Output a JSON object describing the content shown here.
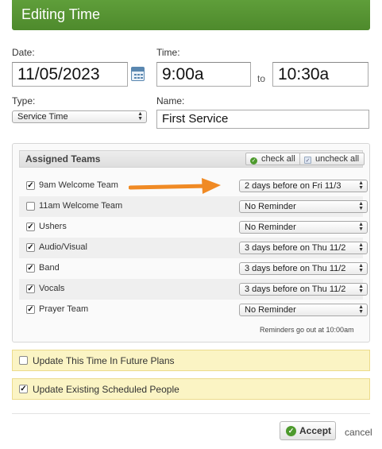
{
  "header": {
    "title": "Editing Time"
  },
  "form": {
    "date_label": "Date:",
    "date_value": "11/05/2023",
    "time_label": "Time:",
    "time_start": "9:00a",
    "to_label": "to",
    "time_end": "10:30a",
    "type_label": "Type:",
    "type_value": "Service Time",
    "name_label": "Name:",
    "name_value": "First Service"
  },
  "assigned_teams": {
    "title": "Assigned Teams",
    "check_all": "check all",
    "uncheck_all": "uncheck all",
    "teams": [
      {
        "name": "9am Welcome Team",
        "checked": true,
        "reminder": "2 days before on Fri 11/3"
      },
      {
        "name": "11am Welcome Team",
        "checked": false,
        "reminder": "No Reminder"
      },
      {
        "name": "Ushers",
        "checked": true,
        "reminder": "No Reminder"
      },
      {
        "name": "Audio/Visual",
        "checked": true,
        "reminder": "3 days before on Thu 11/2"
      },
      {
        "name": "Band",
        "checked": true,
        "reminder": "3 days before on Thu 11/2"
      },
      {
        "name": "Vocals",
        "checked": true,
        "reminder": "3 days before on Thu 11/2"
      },
      {
        "name": "Prayer Team",
        "checked": true,
        "reminder": "No Reminder"
      }
    ],
    "footnote": "Reminders go out at 10:00am"
  },
  "options": {
    "update_future": {
      "label": "Update This Time In Future Plans",
      "checked": false
    },
    "update_existing": {
      "label": "Update Existing Scheduled People",
      "checked": true
    }
  },
  "actions": {
    "accept": "Accept",
    "cancel": "cancel"
  },
  "colors": {
    "header": "#5a9a36",
    "arrow": "#f08a24",
    "highlight": "#fbf4c4",
    "check_icon": "#4d9a2d"
  }
}
